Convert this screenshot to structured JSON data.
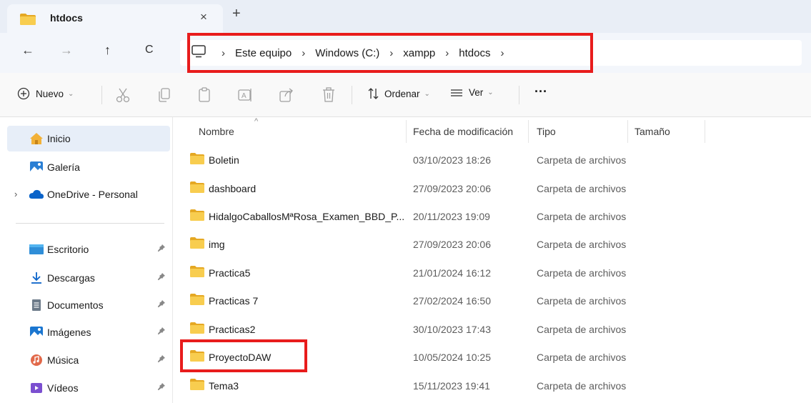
{
  "tab": {
    "title": "htdocs",
    "close": "×",
    "new": "+"
  },
  "nav": {
    "back": "←",
    "forward": "→",
    "up": "↑",
    "refresh": "C"
  },
  "breadcrumb": {
    "sep": "›",
    "items": [
      "Este equipo",
      "Windows (C:)",
      "xampp",
      "htdocs"
    ]
  },
  "toolbar": {
    "new_label": "Nuevo",
    "sort_label": "Ordenar",
    "view_label": "Ver",
    "more": "···",
    "chev": "⌄"
  },
  "sidebar": {
    "items": [
      {
        "label": "Inicio",
        "icon": "home-icon"
      },
      {
        "label": "Galería",
        "icon": "gallery-icon"
      },
      {
        "label": "OneDrive - Personal",
        "icon": "cloud-icon"
      },
      {
        "label": "Escritorio",
        "icon": "desktop-icon"
      },
      {
        "label": "Descargas",
        "icon": "download-icon"
      },
      {
        "label": "Documentos",
        "icon": "document-icon"
      },
      {
        "label": "Imágenes",
        "icon": "pictures-icon"
      },
      {
        "label": "Música",
        "icon": "music-icon"
      },
      {
        "label": "Vídeos",
        "icon": "videos-icon"
      }
    ],
    "expand": "›",
    "pin": "✦"
  },
  "columns": {
    "name": "Nombre",
    "date": "Fecha de modificación",
    "type": "Tipo",
    "size": "Tamaño",
    "sort_caret": "^"
  },
  "files": [
    {
      "name": "Boletin",
      "date": "03/10/2023 18:26",
      "type": "Carpeta de archivos"
    },
    {
      "name": "dashboard",
      "date": "27/09/2023 20:06",
      "type": "Carpeta de archivos"
    },
    {
      "name": "HidalgoCaballosMªRosa_Examen_BBD_P...",
      "date": "20/11/2023 19:09",
      "type": "Carpeta de archivos"
    },
    {
      "name": "img",
      "date": "27/09/2023 20:06",
      "type": "Carpeta de archivos"
    },
    {
      "name": "Practica5",
      "date": "21/01/2024 16:12",
      "type": "Carpeta de archivos"
    },
    {
      "name": "Practicas 7",
      "date": "27/02/2024 16:50",
      "type": "Carpeta de archivos"
    },
    {
      "name": "Practicas2",
      "date": "30/10/2023 17:43",
      "type": "Carpeta de archivos"
    },
    {
      "name": "ProyectoDAW",
      "date": "10/05/2024 10:25",
      "type": "Carpeta de archivos"
    },
    {
      "name": "Tema3",
      "date": "15/11/2023 19:41",
      "type": "Carpeta de archivos"
    }
  ],
  "colors": {
    "highlight": "#e81c1c",
    "folder": "#f8cd4f",
    "folder_dark": "#e5a823",
    "accent": "#0067c0"
  }
}
